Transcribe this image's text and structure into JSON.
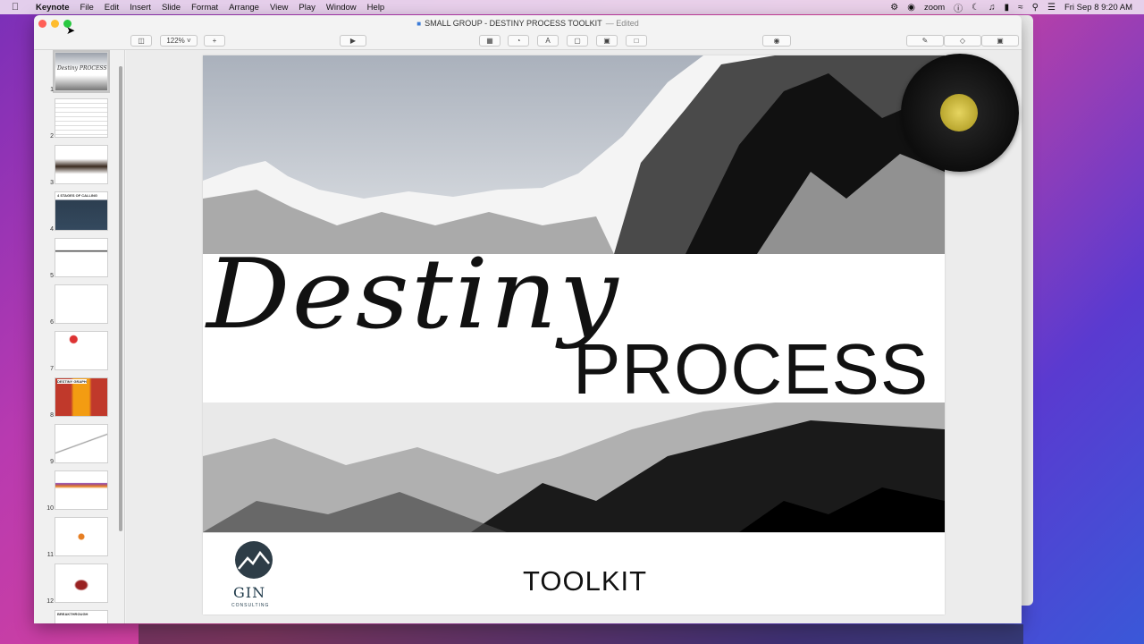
{
  "menubar": {
    "app": "Keynote",
    "items": [
      "File",
      "Edit",
      "Insert",
      "Slide",
      "Format",
      "Arrange",
      "View",
      "Play",
      "Window",
      "Help"
    ],
    "status_zoom": "zoom",
    "clock": "Fri Sep 8  9:20 AM"
  },
  "window": {
    "title": "SMALL GROUP - DESTINY PROCESS TOOLKIT",
    "edited": "— Edited"
  },
  "toolbar": {
    "zoom_value": "122%"
  },
  "sidebar": {
    "slides": [
      {
        "num": "1",
        "label": "Destiny PROCESS"
      },
      {
        "num": "2",
        "label": ""
      },
      {
        "num": "3",
        "label": ""
      },
      {
        "num": "4",
        "label": "4 STAGES OF CALLING"
      },
      {
        "num": "5",
        "label": ""
      },
      {
        "num": "6",
        "label": ""
      },
      {
        "num": "7",
        "label": ""
      },
      {
        "num": "8",
        "label": "DESTINY GRAPH"
      },
      {
        "num": "9",
        "label": ""
      },
      {
        "num": "10",
        "label": ""
      },
      {
        "num": "11",
        "label": ""
      },
      {
        "num": "12",
        "label": ""
      }
    ],
    "next_label": "BREAKTHROUGH"
  },
  "slide": {
    "script_word": "Destiny",
    "headline": "PROCESS",
    "footer_word": "TOOLKIT",
    "logo_text": "GIN",
    "logo_sub": "CONSULTING"
  },
  "colors": {
    "window_bg": "#f3f3f3",
    "selection": "#c4c4c4",
    "text": "#111111"
  }
}
